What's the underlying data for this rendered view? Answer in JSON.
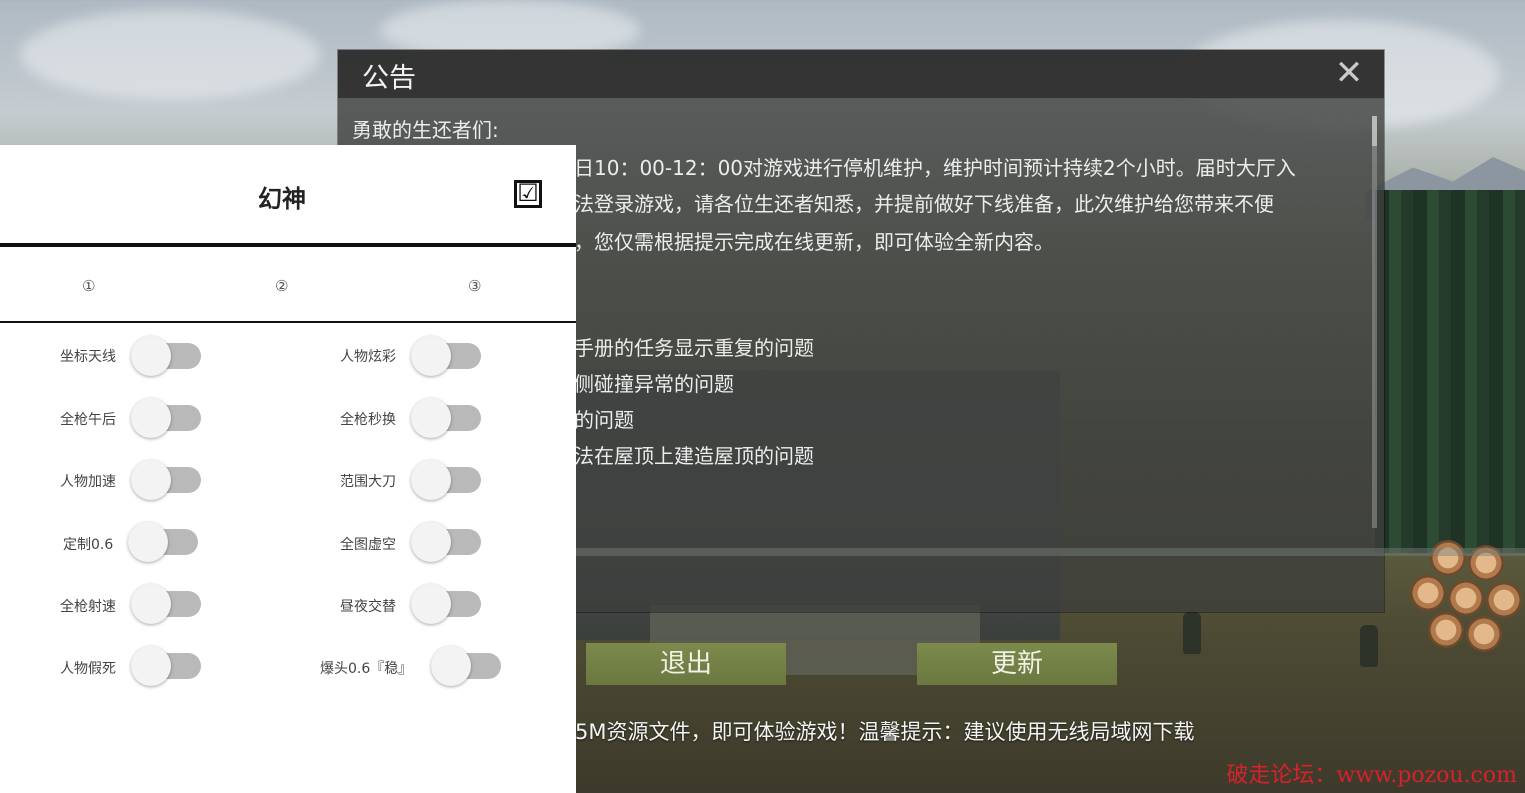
{
  "announcement": {
    "title": "公告",
    "lines": [
      "勇敢的生还者们:",
      "日10：00-12：00对游戏进行停机维护，维护时间预计持续2个小时。届时大厅入",
      "法登录游戏，请各位生还者知悉，并提前做好下线准备，此次维护给您带来不便",
      "，您仅需根据提示完成在线更新，即可体验全新内容。",
      "手册的任务显示重复的问题",
      "侧碰撞异常的问题",
      "的问题",
      "法在屋顶上建造屋顶的问题"
    ],
    "buttons": {
      "exit": "退出",
      "update": "更新"
    },
    "download_tip": "5M资源文件，即可体验游戏！温馨提示：建议使用无线局域网下载",
    "close_icon": "close-icon"
  },
  "panel": {
    "title": "幻神",
    "checked_mark": "☑",
    "tabs": [
      "①",
      "②",
      "③"
    ],
    "left_options": [
      {
        "label": "坐标天线",
        "on": false
      },
      {
        "label": "全枪午后",
        "on": false
      },
      {
        "label": "人物加速",
        "on": false
      },
      {
        "label": "定制0.6",
        "on": false
      },
      {
        "label": "全枪射速",
        "on": false
      },
      {
        "label": "人物假死",
        "on": false
      }
    ],
    "right_options": [
      {
        "label": "人物炫彩",
        "on": false
      },
      {
        "label": "全枪秒换",
        "on": false
      },
      {
        "label": "范围大刀",
        "on": false
      },
      {
        "label": "全图虚空",
        "on": false
      },
      {
        "label": "昼夜交替",
        "on": false
      },
      {
        "label": "爆头0.6『稳』",
        "on": false
      }
    ]
  },
  "watermark": "破走论坛：www.pozou.com"
}
